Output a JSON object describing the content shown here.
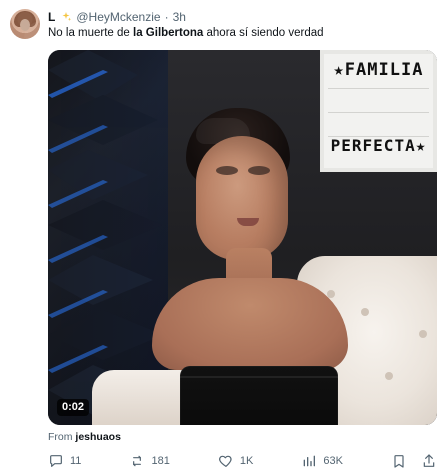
{
  "tweet": {
    "author": {
      "display_name": "L",
      "handle": "@HeyMckenzie",
      "separator": "·",
      "time": "3h",
      "avatar_icon": "avatar"
    },
    "text": {
      "before": "No la muerte de ",
      "bold": "la Gilbertona",
      "after": " ahora sí siendo verdad"
    },
    "media": {
      "video_time": "0:02",
      "lightbox_line1": "★FAMILIA",
      "lightbox_line2": "PERFECTA★"
    },
    "from": {
      "prefix": "From",
      "user": "jeshuaos"
    },
    "actions": {
      "replies": "11",
      "reposts": "181",
      "likes": "1K",
      "views": "63K"
    }
  },
  "colors": {
    "text_primary": "#0f1419",
    "text_secondary": "#536471",
    "sparkles": "#f4c542",
    "video_badge_bg": "#000000"
  },
  "icons": {
    "sparkles": "sparkles-icon",
    "reply": "reply-icon",
    "repost": "repost-icon",
    "like": "like-icon",
    "views": "views-icon",
    "bookmark": "bookmark-icon",
    "share": "share-icon"
  }
}
